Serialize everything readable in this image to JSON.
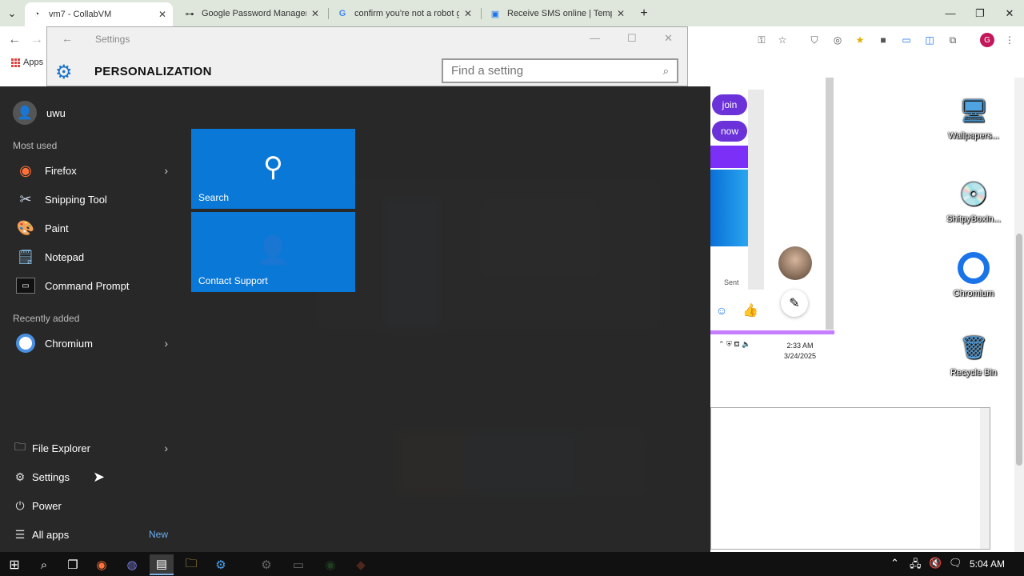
{
  "browser": {
    "tabs": [
      {
        "title": "vm7 - CollabVM",
        "active": true
      },
      {
        "title": "Google Password Manager",
        "active": false
      },
      {
        "title": "confirm you're not a robot goo",
        "active": false
      },
      {
        "title": "Receive SMS online | Tempora",
        "active": false
      }
    ],
    "bookmarks_apps_label": "Apps",
    "profile_initial": "G"
  },
  "settings_window": {
    "title": "Settings",
    "heading": "PERSONALIZATION",
    "search_placeholder": "Find a setting"
  },
  "start_menu": {
    "user_name": "uwu",
    "most_used_label": "Most used",
    "most_used": [
      {
        "label": "Firefox",
        "has_submenu": true
      },
      {
        "label": "Snipping Tool",
        "has_submenu": false
      },
      {
        "label": "Paint",
        "has_submenu": false
      },
      {
        "label": "Notepad",
        "has_submenu": false
      },
      {
        "label": "Command Prompt",
        "has_submenu": false
      }
    ],
    "recently_added_label": "Recently added",
    "recently_added": [
      {
        "label": "Chromium",
        "has_submenu": true
      }
    ],
    "system_items": [
      {
        "label": "File Explorer",
        "has_submenu": true
      },
      {
        "label": "Settings"
      },
      {
        "label": "Power"
      },
      {
        "label": "All apps",
        "badge": "New"
      }
    ],
    "tiles": [
      {
        "label": "Search"
      },
      {
        "label": "Contact Support"
      }
    ]
  },
  "vm_desktop": {
    "chat_buttons": [
      "join",
      "now"
    ],
    "sent_label": "Sent",
    "inner_clock_time": "2:33 AM",
    "inner_clock_date": "3/24/2025",
    "icons": [
      {
        "label": "Wallpapers..."
      },
      {
        "label": "ShitpyBoxIn..."
      },
      {
        "label": "Chromium"
      },
      {
        "label": "Recycle Bin"
      }
    ]
  },
  "taskbar": {
    "clock": "5:04 AM"
  },
  "colors": {
    "tile_blue": "#0a78d7",
    "start_bg": "#282828",
    "accent_purple": "#6a32d8"
  }
}
